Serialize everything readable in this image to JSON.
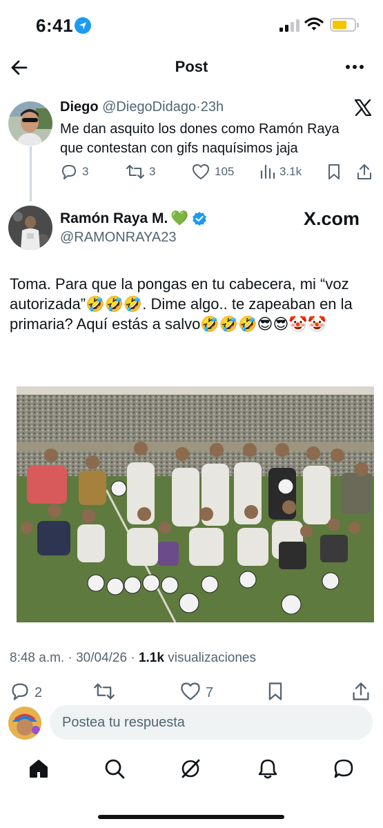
{
  "status_bar": {
    "time": "6:41"
  },
  "header": {
    "title": "Post"
  },
  "reply_tweet": {
    "name": "Diego",
    "handle": "@DiegoDidago",
    "separator": "·",
    "time": "23h",
    "text": "Me dan asquito los dones como Ramón Raya que contestan con gifs naquísimos jaja",
    "replies": "3",
    "retweets": "3",
    "likes": "105",
    "views": "3.1k"
  },
  "main_tweet": {
    "name": "Ramón Raya M.",
    "name_emoji": "💚",
    "handle": "@RAMONRAYA23",
    "watermark": "X.com",
    "text": "Toma. Para que la pongas en tu cabecera, mi “voz autorizada”🤣🤣🤣. Dime algo.. te zapeaban en la primaria? Aquí estás a salvo🤣🤣🤣😎😎🤡🤡",
    "timestamp": "8:48 a.m. · 30/04/26 · ",
    "views_count": "1.1k",
    "views_label": " visualizaciones",
    "replies": "2",
    "likes": "7"
  },
  "reply_bar": {
    "placeholder": "Postea tu respuesta"
  },
  "icons": {
    "location": "location-arrow-icon",
    "back": "back-arrow-icon",
    "more": "more-icon",
    "reply": "reply-icon",
    "retweet": "retweet-icon",
    "like": "heart-icon",
    "views": "views-icon",
    "bookmark": "bookmark-icon",
    "share": "share-icon",
    "verified": "verified-badge-icon",
    "nav": [
      "home-icon",
      "search-icon",
      "grok-icon",
      "bell-icon",
      "messages-icon"
    ]
  },
  "colors": {
    "accent": "#1d9bf0",
    "muted": "#536471",
    "text": "#0f1419",
    "battery": "#f5c400"
  }
}
